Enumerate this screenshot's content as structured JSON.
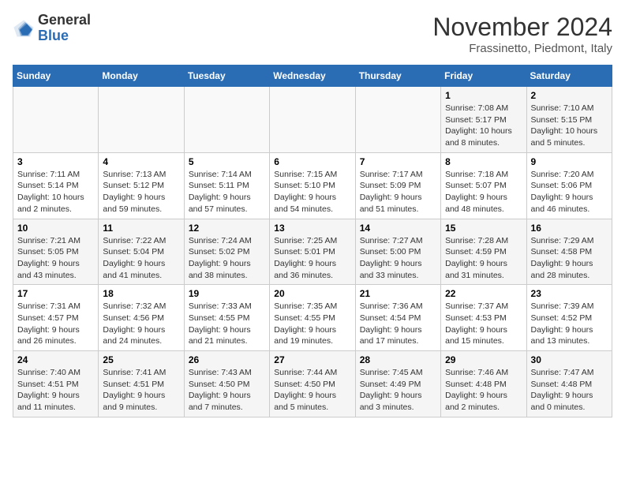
{
  "logo": {
    "general": "General",
    "blue": "Blue"
  },
  "title": "November 2024",
  "location": "Frassinetto, Piedmont, Italy",
  "weekdays": [
    "Sunday",
    "Monday",
    "Tuesday",
    "Wednesday",
    "Thursday",
    "Friday",
    "Saturday"
  ],
  "weeks": [
    [
      {
        "day": "",
        "info": ""
      },
      {
        "day": "",
        "info": ""
      },
      {
        "day": "",
        "info": ""
      },
      {
        "day": "",
        "info": ""
      },
      {
        "day": "",
        "info": ""
      },
      {
        "day": "1",
        "info": "Sunrise: 7:08 AM\nSunset: 5:17 PM\nDaylight: 10 hours and 8 minutes."
      },
      {
        "day": "2",
        "info": "Sunrise: 7:10 AM\nSunset: 5:15 PM\nDaylight: 10 hours and 5 minutes."
      }
    ],
    [
      {
        "day": "3",
        "info": "Sunrise: 7:11 AM\nSunset: 5:14 PM\nDaylight: 10 hours and 2 minutes."
      },
      {
        "day": "4",
        "info": "Sunrise: 7:13 AM\nSunset: 5:12 PM\nDaylight: 9 hours and 59 minutes."
      },
      {
        "day": "5",
        "info": "Sunrise: 7:14 AM\nSunset: 5:11 PM\nDaylight: 9 hours and 57 minutes."
      },
      {
        "day": "6",
        "info": "Sunrise: 7:15 AM\nSunset: 5:10 PM\nDaylight: 9 hours and 54 minutes."
      },
      {
        "day": "7",
        "info": "Sunrise: 7:17 AM\nSunset: 5:09 PM\nDaylight: 9 hours and 51 minutes."
      },
      {
        "day": "8",
        "info": "Sunrise: 7:18 AM\nSunset: 5:07 PM\nDaylight: 9 hours and 48 minutes."
      },
      {
        "day": "9",
        "info": "Sunrise: 7:20 AM\nSunset: 5:06 PM\nDaylight: 9 hours and 46 minutes."
      }
    ],
    [
      {
        "day": "10",
        "info": "Sunrise: 7:21 AM\nSunset: 5:05 PM\nDaylight: 9 hours and 43 minutes."
      },
      {
        "day": "11",
        "info": "Sunrise: 7:22 AM\nSunset: 5:04 PM\nDaylight: 9 hours and 41 minutes."
      },
      {
        "day": "12",
        "info": "Sunrise: 7:24 AM\nSunset: 5:02 PM\nDaylight: 9 hours and 38 minutes."
      },
      {
        "day": "13",
        "info": "Sunrise: 7:25 AM\nSunset: 5:01 PM\nDaylight: 9 hours and 36 minutes."
      },
      {
        "day": "14",
        "info": "Sunrise: 7:27 AM\nSunset: 5:00 PM\nDaylight: 9 hours and 33 minutes."
      },
      {
        "day": "15",
        "info": "Sunrise: 7:28 AM\nSunset: 4:59 PM\nDaylight: 9 hours and 31 minutes."
      },
      {
        "day": "16",
        "info": "Sunrise: 7:29 AM\nSunset: 4:58 PM\nDaylight: 9 hours and 28 minutes."
      }
    ],
    [
      {
        "day": "17",
        "info": "Sunrise: 7:31 AM\nSunset: 4:57 PM\nDaylight: 9 hours and 26 minutes."
      },
      {
        "day": "18",
        "info": "Sunrise: 7:32 AM\nSunset: 4:56 PM\nDaylight: 9 hours and 24 minutes."
      },
      {
        "day": "19",
        "info": "Sunrise: 7:33 AM\nSunset: 4:55 PM\nDaylight: 9 hours and 21 minutes."
      },
      {
        "day": "20",
        "info": "Sunrise: 7:35 AM\nSunset: 4:55 PM\nDaylight: 9 hours and 19 minutes."
      },
      {
        "day": "21",
        "info": "Sunrise: 7:36 AM\nSunset: 4:54 PM\nDaylight: 9 hours and 17 minutes."
      },
      {
        "day": "22",
        "info": "Sunrise: 7:37 AM\nSunset: 4:53 PM\nDaylight: 9 hours and 15 minutes."
      },
      {
        "day": "23",
        "info": "Sunrise: 7:39 AM\nSunset: 4:52 PM\nDaylight: 9 hours and 13 minutes."
      }
    ],
    [
      {
        "day": "24",
        "info": "Sunrise: 7:40 AM\nSunset: 4:51 PM\nDaylight: 9 hours and 11 minutes."
      },
      {
        "day": "25",
        "info": "Sunrise: 7:41 AM\nSunset: 4:51 PM\nDaylight: 9 hours and 9 minutes."
      },
      {
        "day": "26",
        "info": "Sunrise: 7:43 AM\nSunset: 4:50 PM\nDaylight: 9 hours and 7 minutes."
      },
      {
        "day": "27",
        "info": "Sunrise: 7:44 AM\nSunset: 4:50 PM\nDaylight: 9 hours and 5 minutes."
      },
      {
        "day": "28",
        "info": "Sunrise: 7:45 AM\nSunset: 4:49 PM\nDaylight: 9 hours and 3 minutes."
      },
      {
        "day": "29",
        "info": "Sunrise: 7:46 AM\nSunset: 4:48 PM\nDaylight: 9 hours and 2 minutes."
      },
      {
        "day": "30",
        "info": "Sunrise: 7:47 AM\nSunset: 4:48 PM\nDaylight: 9 hours and 0 minutes."
      }
    ]
  ]
}
